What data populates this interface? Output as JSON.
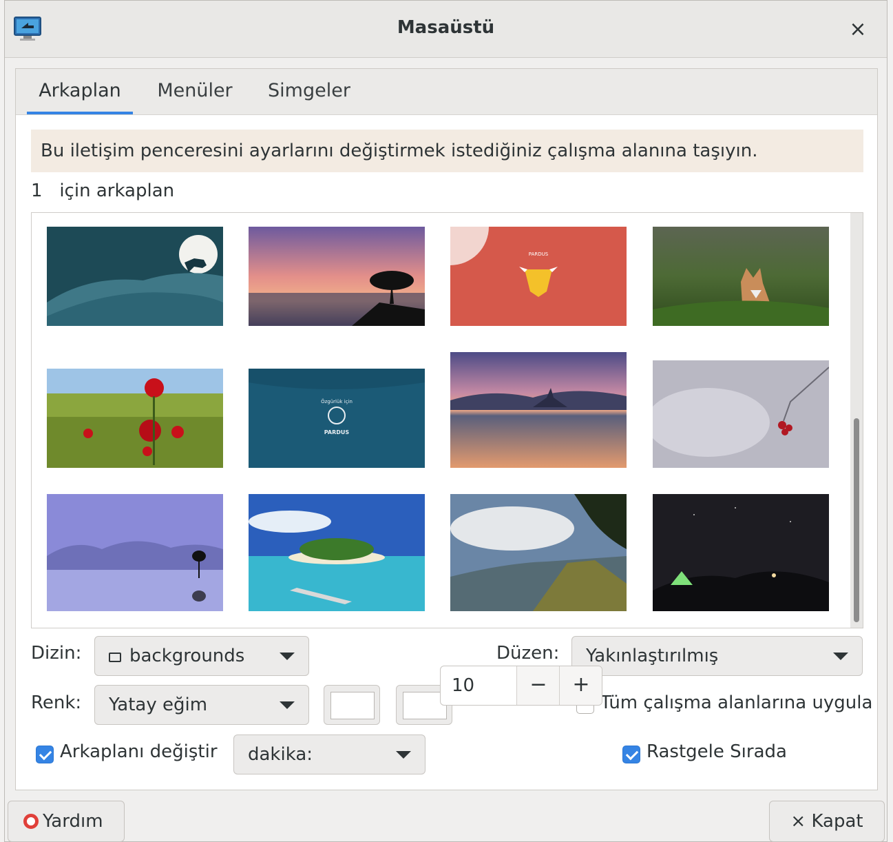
{
  "window": {
    "title": "Masaüstü",
    "close_glyph": "×"
  },
  "tabs": [
    {
      "label": "Arkaplan",
      "active": true
    },
    {
      "label": "Menüler",
      "active": false
    },
    {
      "label": "Simgeler",
      "active": false
    }
  ],
  "infobar": {
    "text": "Bu iletişim penceresini ayarlarını değiştirmek istediğiniz çalışma alanına taşıyın."
  },
  "workspace_label": "1   için arkaplan",
  "controls": {
    "folder_label": "Dizin:",
    "folder_value": "backgrounds",
    "style_label": "Düzen:",
    "style_value": "Yakınlaştırılmış",
    "color_label": "Renk:",
    "color_value": "Yatay eğim",
    "apply_all_label": "Tüm çalışma alanlarına uygula",
    "apply_all_checked": false,
    "change_bg_label": "Arkaplanı değiştir",
    "change_bg_checked": true,
    "interval_unit": "dakika:",
    "interval_value": "10",
    "minus": "−",
    "plus": "+",
    "random_label": "Rastgele Sırada",
    "random_checked": true
  },
  "footer": {
    "help_label": "Yardım",
    "close_label": "× Kapat"
  },
  "icons": [
    "desktop-app-icon",
    "close-icon",
    "folder-icon",
    "chevron-down-icon",
    "lifebuoy-icon"
  ],
  "thumbnails": [
    {
      "name": "wolf-moon-teal",
      "text": ""
    },
    {
      "name": "sunset-tree-sea",
      "text": ""
    },
    {
      "name": "pardus-lion-red",
      "text": "PARDUS"
    },
    {
      "name": "fox-grass",
      "text": ""
    },
    {
      "name": "red-poppies-field",
      "text": ""
    },
    {
      "name": "pardus-teal-logo",
      "text": "Özgürlük için PARDUS"
    },
    {
      "name": "lake-island-sunset",
      "text": ""
    },
    {
      "name": "red-berries-winter",
      "text": ""
    },
    {
      "name": "lavender-lake-tree",
      "text": ""
    },
    {
      "name": "tropical-island-boat",
      "text": ""
    },
    {
      "name": "terraced-hills-clouds",
      "text": ""
    },
    {
      "name": "night-sky-tent",
      "text": ""
    }
  ]
}
